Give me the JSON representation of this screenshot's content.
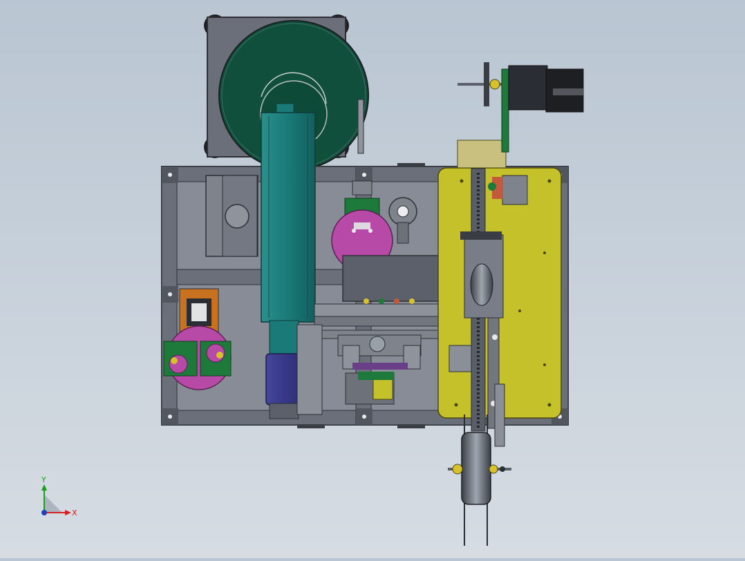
{
  "view": {
    "background_top": "#b9c5d2",
    "background_bottom": "#d6dce2"
  },
  "triad": {
    "x_label": "X",
    "y_label": "Y",
    "x_color": "#d42020",
    "y_color": "#19a019",
    "z_color": "#1a3fbf"
  },
  "palette": {
    "frame": "#5e6470",
    "frame_light": "#8a909a",
    "hopper_body": "#0f4f3c",
    "column": "#1a7a78",
    "motor": "#3a3a8c",
    "plate": "#c4c12a",
    "magenta": "#b74aa6",
    "pcb": "#1e7a3a",
    "orange": "#c8711e",
    "dark": "#2a2d33"
  },
  "components": [
    "outline-frame",
    "hopper-bowl",
    "vertical-column",
    "main-plate",
    "stepper-motor",
    "reel",
    "conveyor-rail"
  ]
}
